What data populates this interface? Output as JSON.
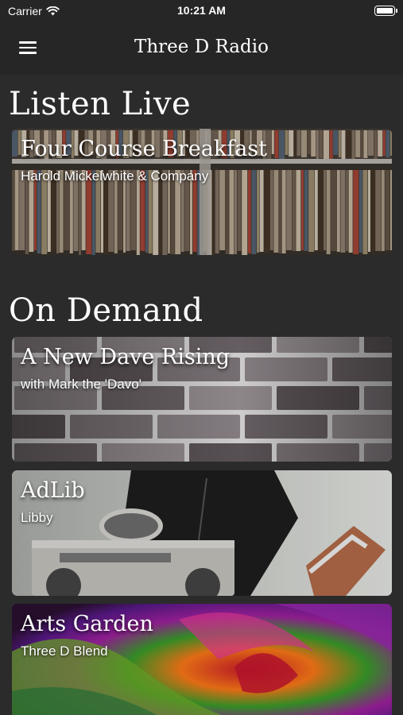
{
  "status_bar": {
    "carrier": "Carrier",
    "time": "10:21 AM",
    "wifi_icon": "wifi-icon",
    "battery_icon": "battery-icon"
  },
  "nav": {
    "title": "Three D Radio",
    "menu_icon": "hamburger-menu-icon"
  },
  "listen_live": {
    "heading": "Listen Live",
    "card": {
      "title": "Four Course Breakfast",
      "subtitle": "Harold Mickelwhite & Company"
    }
  },
  "on_demand": {
    "heading": "On Demand",
    "programs": [
      {
        "title": "A New Dave Rising",
        "subtitle": "with Mark the 'Davo'"
      },
      {
        "title": "AdLib",
        "subtitle": "Libby"
      },
      {
        "title": "Arts Garden",
        "subtitle": "Three D Blend"
      }
    ]
  }
}
